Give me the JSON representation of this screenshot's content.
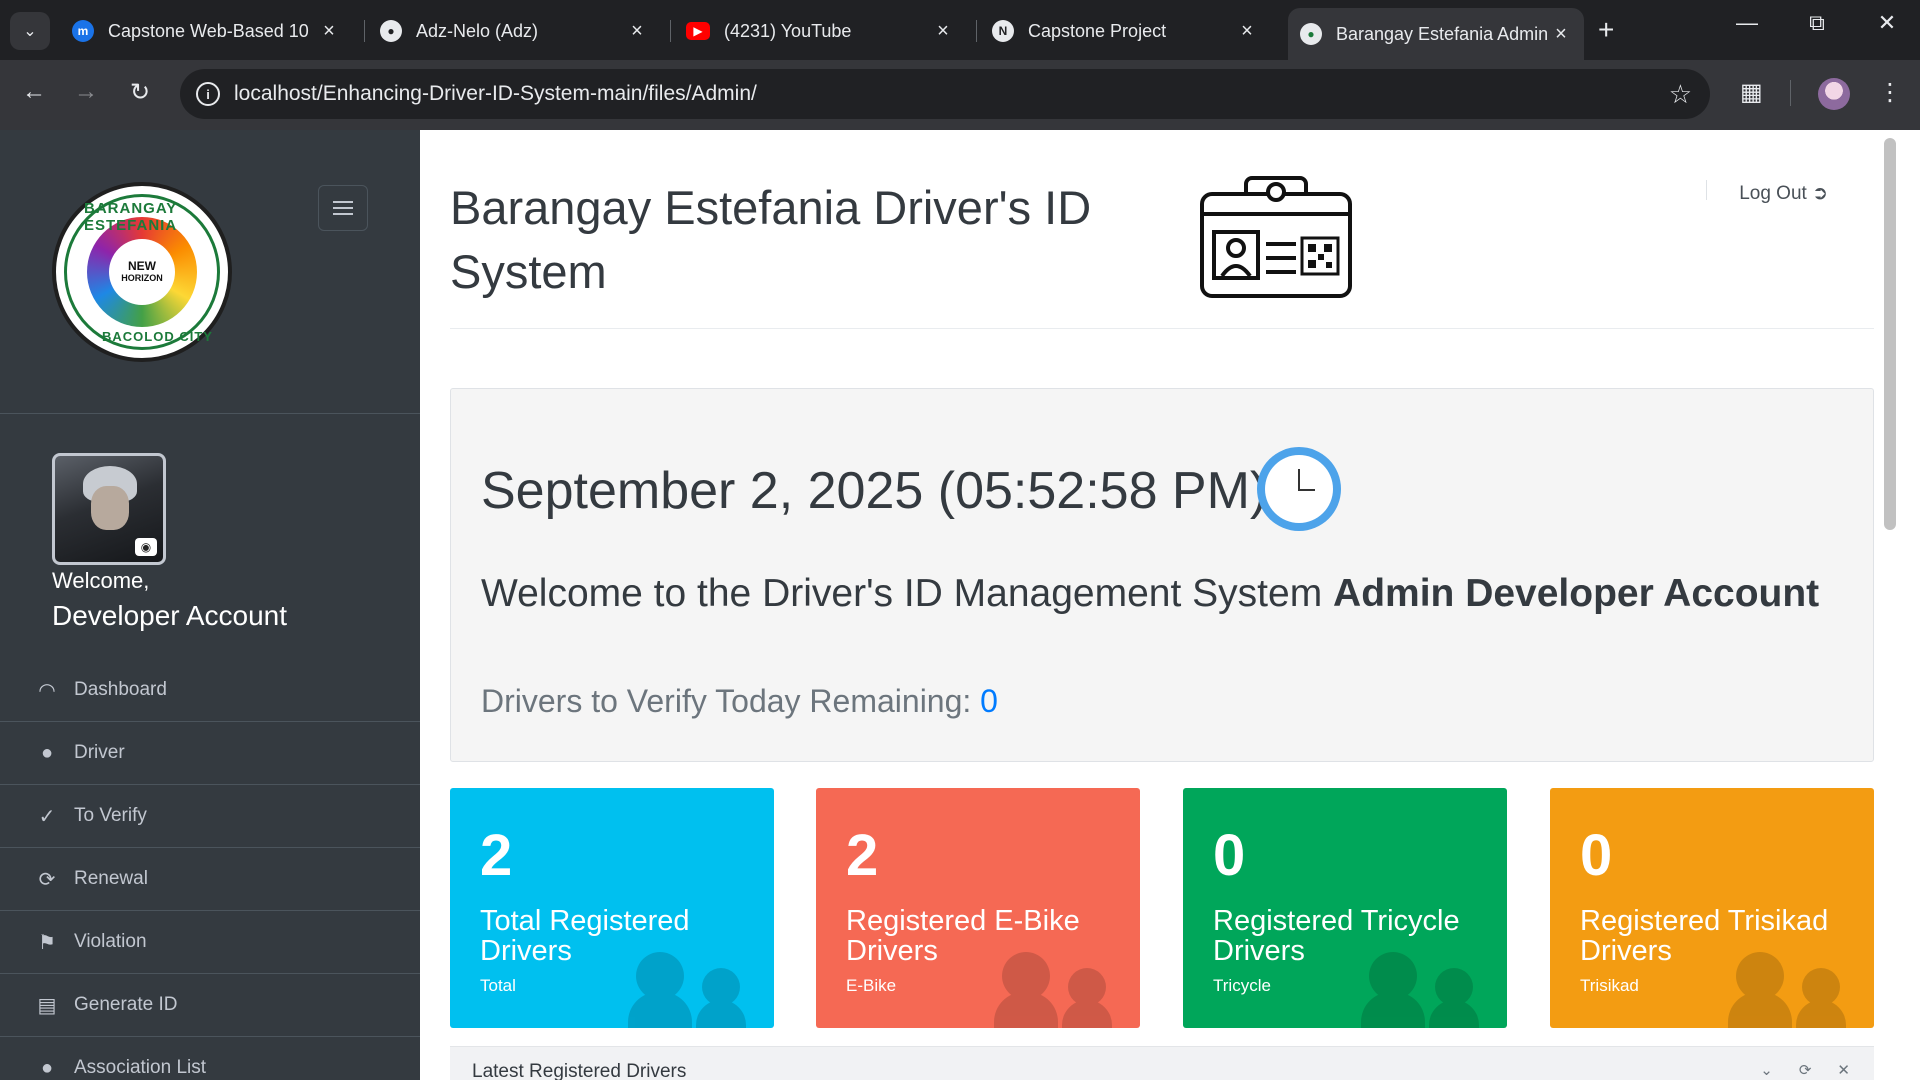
{
  "browser": {
    "tabs": [
      {
        "title": "Capstone Web-Based 10"
      },
      {
        "title": "Adz-Nelo (Adz)"
      },
      {
        "title": "(4231) YouTube"
      },
      {
        "title": "Capstone Project"
      },
      {
        "title": "Barangay Estefania Admin"
      }
    ],
    "url": "localhost/Enhancing-Driver-ID-System-main/files/Admin/"
  },
  "sidebar": {
    "logo": {
      "top_text": "BARANGAY ESTEFANIA",
      "inner_line1": "NEW",
      "inner_line2": "HORIZON",
      "bottom_text": "BACOLOD CITY"
    },
    "welcome": "Welcome,",
    "username": "Developer Account",
    "items": [
      {
        "label": "Dashboard",
        "icon": "tachometer-icon"
      },
      {
        "label": "Driver",
        "icon": "user-icon"
      },
      {
        "label": "To Verify",
        "icon": "check-icon"
      },
      {
        "label": "Renewal",
        "icon": "refresh-icon"
      },
      {
        "label": "Violation",
        "icon": "flag-icon"
      },
      {
        "label": "Generate ID",
        "icon": "id-card-icon"
      },
      {
        "label": "Association List",
        "icon": "users-icon"
      }
    ]
  },
  "header": {
    "title": "Barangay Estefania Driver's ID System",
    "logout": "Log Out"
  },
  "jumbotron": {
    "datetime": "September 2, 2025 (05:52:58 PM)",
    "welcome_prefix": "Welcome to the Driver's ID Management System",
    "welcome_bold": "Admin Developer Account",
    "verify_label": "Drivers to Verify Today Remaining:",
    "verify_count": "0"
  },
  "stats": [
    {
      "number": "2",
      "label": "Total Registered Drivers",
      "sub": "Total",
      "color": "#00c0ef"
    },
    {
      "number": "2",
      "label": "Registered E-Bike Drivers",
      "sub": "E-Bike",
      "color": "#f56954"
    },
    {
      "number": "0",
      "label": "Registered Tricycle Drivers",
      "sub": "Tricycle",
      "color": "#00a65a"
    },
    {
      "number": "0",
      "label": "Registered Trisikad Drivers",
      "sub": "Trisikad",
      "color": "#f39c12"
    }
  ],
  "latest_panel": {
    "title": "Latest Registered Drivers"
  }
}
